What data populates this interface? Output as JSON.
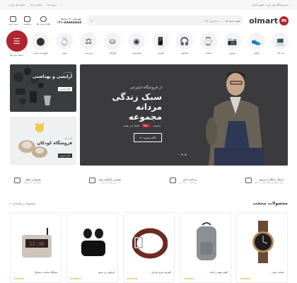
{
  "topbar": {
    "welcome": "به فروشگاه اول مارت خوش آمدید",
    "links": [
      "درباره ما",
      "تماس با ما",
      "مجله اول مارت"
    ]
  },
  "header": {
    "logo_text": "olmart",
    "search_category": "همه دسته ها",
    "search_placeholder": "جستجوی کالا ...",
    "phone_label": "پشتیبانی ۲۴ ساعته",
    "phone_number": "۰۲۱-۸۸۸۸۸۸۸۸",
    "icons": [
      {
        "name": "cart-icon",
        "label": "سبد خرید"
      },
      {
        "name": "compare-icon",
        "label": "مقایسه"
      },
      {
        "name": "heart-icon",
        "label": "علاقه مندی ها"
      }
    ]
  },
  "categories": [
    {
      "label": "لپ تاپ",
      "icon": "laptop-icon"
    },
    {
      "label": "کفش",
      "icon": "shoe-icon"
    },
    {
      "label": "دوربین",
      "icon": "camera-icon"
    },
    {
      "label": "ساعت",
      "icon": "watch-icon"
    },
    {
      "label": "هدفون",
      "icon": "headphone-icon"
    },
    {
      "label": "گوشی",
      "icon": "phone-icon"
    },
    {
      "label": "هندزفری",
      "icon": "earbuds-icon"
    },
    {
      "label": "کودکان",
      "icon": "stroller-icon"
    },
    {
      "label": "ورزشی",
      "icon": "dumbbell-icon"
    },
    {
      "label": "زینتی",
      "icon": "ring-icon"
    },
    {
      "label": "تجهیزات جانبی",
      "icon": "accessory-icon"
    },
    {
      "label": "دسته بندی ها",
      "icon": "grid-icon",
      "active": true
    }
  ],
  "hero": {
    "subtitle": "از فروشگاه اینترنتی",
    "title_line1": "سبک زندگی مردانه",
    "title_line2": "مجموعه",
    "discount_prefix": "تخفیف",
    "discount_value": "۵۰%",
    "discount_suffix": "فقط این هفته",
    "button": "الان بخرید"
  },
  "side_banners": [
    {
      "kicker": "جدید در",
      "title": "آرایشی و بهداشتی",
      "button": "الان بخرید"
    },
    {
      "kicker": "تازه ها",
      "title": "فروشگاه کودکان",
      "button": "الان بخرید"
    }
  ],
  "features": [
    {
      "title": "ارسال رایگان و سریع",
      "sub": "برای سفارش های بالای ۵۰ دلار"
    },
    {
      "title": "پرداخت امن",
      "sub": "پرداخت ۱۰۰% امن"
    },
    {
      "title": "تضمین بازگشت پول",
      "sub": "تا ۳۰ روز بعد از خرید"
    },
    {
      "title": "پشتیبانی ماهر",
      "sub": "پشتیبانی ۲۴ ساعته"
    }
  ],
  "section": {
    "title": "محصولات منتخب",
    "link": "محصولات پرطرفدار"
  },
  "products": [
    {
      "name": "ساعت مچی",
      "stars": "★★★★★",
      "icon": "watch-icon"
    },
    {
      "name": "کوله پشتی راحت",
      "stars": "★★★★★",
      "icon": "backpack-icon"
    },
    {
      "name": "کمربند چرم مردانه",
      "stars": "★★★★★",
      "icon": "belt-icon"
    },
    {
      "name": "ایرفون بی سیم",
      "stars": "★★★★★",
      "icon": "earbuds-icon"
    },
    {
      "name": "دستگاه ساعت دیجیتال",
      "stars": "★★★★★",
      "icon": "clock-radio-icon"
    }
  ],
  "colors": {
    "accent": "#b0232f"
  }
}
